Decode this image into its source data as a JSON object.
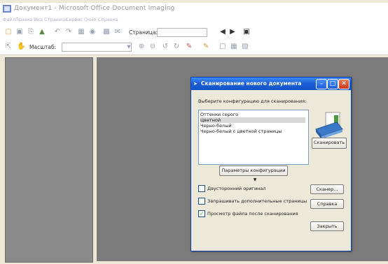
{
  "window": {
    "title": "Документ1 - Microsoft Office Document Imaging"
  },
  "menu": [
    "Файл",
    "Правка",
    "Вид",
    "Страница",
    "Сервис",
    "Окно",
    "Справка"
  ],
  "toolbar": {
    "page_label": "Страница:",
    "page_value": "",
    "zoom_label": "Масштаб:",
    "zoom_value": ""
  },
  "dialog": {
    "title": "Сканирование нового документа",
    "instruction": "Выберите конфигурацию для сканирования:",
    "presets": [
      {
        "label": "Оттенки серого",
        "selected": false
      },
      {
        "label": "Цветной",
        "selected": true
      },
      {
        "label": "Черно-белый",
        "selected": false
      },
      {
        "label": "Черно-белый с цветной страницы",
        "selected": false
      }
    ],
    "scan_button": "Сканировать",
    "preset_options_button": "Параметры конфигурации",
    "checkboxes": [
      {
        "label": "Двусторонний оригинал",
        "checked": false
      },
      {
        "label": "Запрашивать дополнительные страницы",
        "checked": false
      },
      {
        "label": "Просмотр файла после сканирования",
        "checked": true
      }
    ],
    "scanner_button": "Сканер...",
    "help_button": "Справка",
    "close_button": "Закрыть",
    "icons": [
      "scanner-icon"
    ]
  },
  "colors": {
    "dialog_titlebar": "#1b5fd9",
    "workspace": "#7b7b7b",
    "chrome": "#ece9d8"
  }
}
